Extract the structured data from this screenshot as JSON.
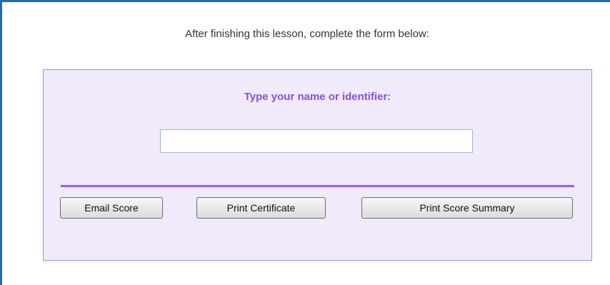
{
  "instruction": "After finishing this lesson, complete the form below:",
  "form": {
    "prompt": "Type your name or identifier:",
    "name_value": "",
    "buttons": {
      "email": "Email Score",
      "certificate": "Print Certificate",
      "summary": "Print Score Summary"
    }
  },
  "colors": {
    "frame_border": "#1e6fb0",
    "panel_background": "#f0eafb",
    "panel_border": "#a58be3",
    "prompt_text": "#8a4fe6",
    "divider": "#9b5cf5"
  }
}
